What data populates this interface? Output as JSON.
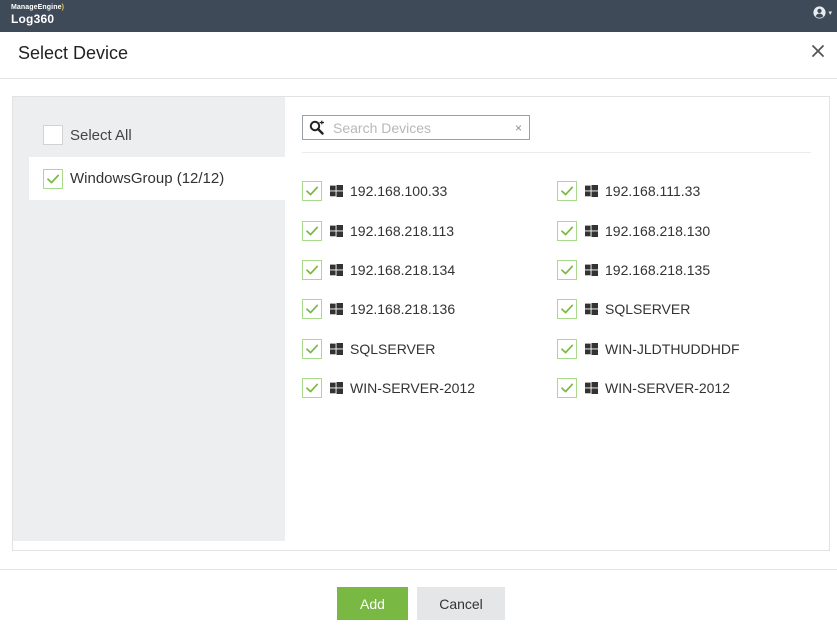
{
  "app": {
    "brand_small": "ManageEngine",
    "brand_name": "Log360",
    "accent_color": "#79b843",
    "topbar_color": "#3f4a59"
  },
  "header_icons": {
    "user": "user-circle-icon",
    "caret": "chevron-down-icon"
  },
  "dialog": {
    "title": "Select Device",
    "close_icon": "close-icon"
  },
  "sidebar": {
    "select_all_label": "Select All",
    "select_all_checked": false,
    "group_label": "WindowsGroup (12/12)",
    "group_checked": true
  },
  "search": {
    "placeholder": "Search Devices",
    "value": "",
    "clear_icon": "×"
  },
  "devices": [
    {
      "name": "192.168.100.33",
      "checked": true
    },
    {
      "name": "192.168.111.33",
      "checked": true
    },
    {
      "name": "192.168.218.113",
      "checked": true
    },
    {
      "name": "192.168.218.130",
      "checked": true
    },
    {
      "name": "192.168.218.134",
      "checked": true
    },
    {
      "name": "192.168.218.135",
      "checked": true
    },
    {
      "name": "192.168.218.136",
      "checked": true
    },
    {
      "name": "SQLSERVER",
      "checked": true
    },
    {
      "name": "SQLSERVER",
      "checked": true
    },
    {
      "name": "WIN-JLDTHUDDHDF",
      "checked": true
    },
    {
      "name": "WIN-SERVER-2012",
      "checked": true
    },
    {
      "name": "WIN-SERVER-2012",
      "checked": true
    }
  ],
  "footer": {
    "add_label": "Add",
    "cancel_label": "Cancel"
  }
}
